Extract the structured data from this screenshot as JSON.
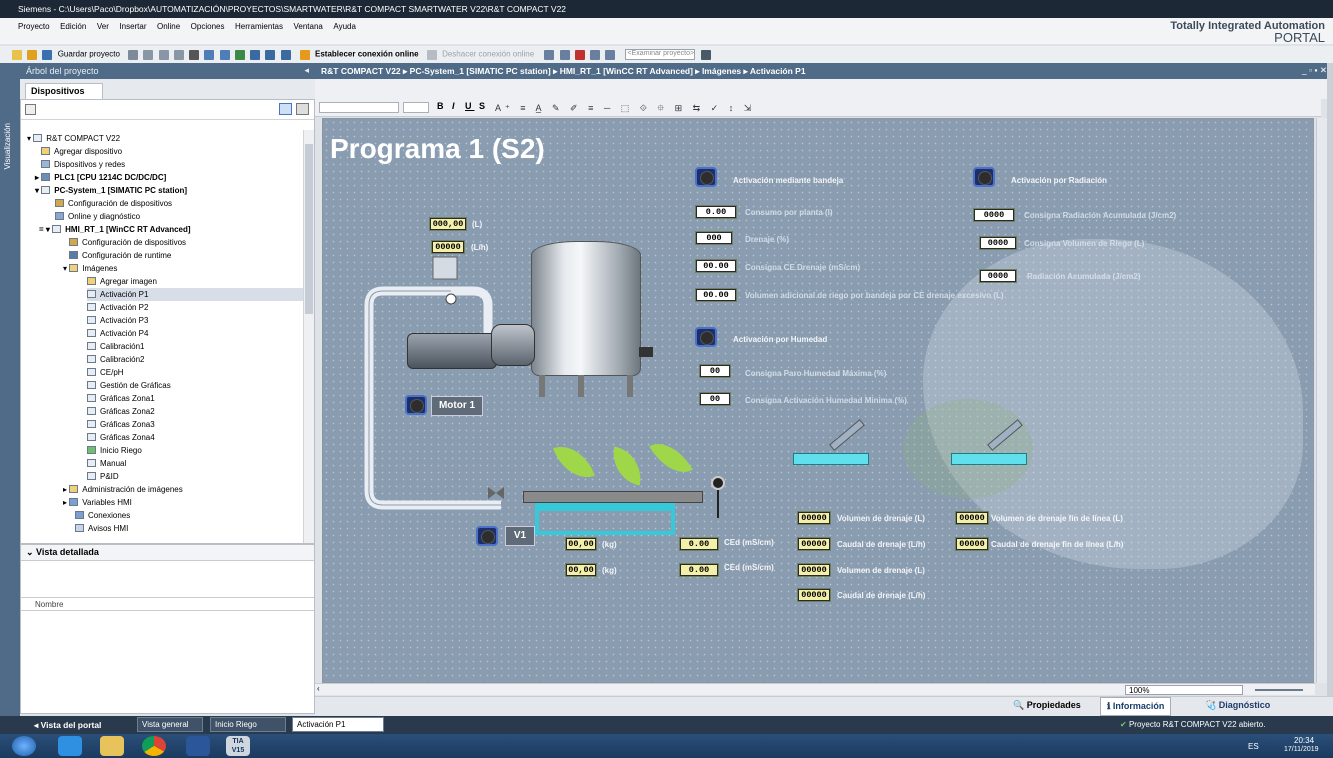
{
  "window": {
    "title": "Siemens - C:\\Users\\Paco\\Dropbox\\AUTOMATIZACIÓN\\PROYECTOS\\SMARTWATER\\R&T COMPACT SMARTWATER V22\\R&T COMPACT V22",
    "brand_line1": "Totally Integrated Automation",
    "brand_line2": "PORTAL"
  },
  "menu": [
    "Proyecto",
    "Edición",
    "Ver",
    "Insertar",
    "Online",
    "Opciones",
    "Herramientas",
    "Ventana",
    "Ayuda"
  ],
  "toolbar": {
    "save": "Guardar proyecto",
    "connect": "Establecer conexión online",
    "disconnect": "Deshacer conexión online",
    "search_placeholder": "<Examinar proyecto>"
  },
  "project_tree": {
    "header": "Árbol del proyecto",
    "tab": "Dispositivos",
    "side_label": "Visualización",
    "items": [
      {
        "label": "R&T COMPACT V22"
      },
      {
        "label": "Agregar dispositivo"
      },
      {
        "label": "Dispositivos y redes"
      },
      {
        "label": "PLC1 [CPU 1214C DC/DC/DC]"
      },
      {
        "label": "PC-System_1 [SIMATIC PC station]"
      },
      {
        "label": "Configuración de dispositivos"
      },
      {
        "label": "Online y diagnóstico"
      },
      {
        "label": "HMI_RT_1 [WinCC RT Advanced]"
      },
      {
        "label": "Configuración de dispositivos"
      },
      {
        "label": "Configuración de runtime"
      },
      {
        "label": "Imágenes"
      },
      {
        "label": "Agregar imagen"
      },
      {
        "label": "Activación P1"
      },
      {
        "label": "Activación P2"
      },
      {
        "label": "Activación P3"
      },
      {
        "label": "Activación P4"
      },
      {
        "label": "Calibración1"
      },
      {
        "label": "Calibración2"
      },
      {
        "label": "CE/pH"
      },
      {
        "label": "Gestión de Gráficas"
      },
      {
        "label": "Gráficas Zona1"
      },
      {
        "label": "Gráficas Zona2"
      },
      {
        "label": "Gráficas Zona3"
      },
      {
        "label": "Gráficas Zona4"
      },
      {
        "label": "Inicio Riego"
      },
      {
        "label": "Manual"
      },
      {
        "label": "P&ID"
      },
      {
        "label": "Administración de imágenes"
      },
      {
        "label": "Variables HMI"
      },
      {
        "label": "Conexiones"
      },
      {
        "label": "Avisos HMI"
      }
    ],
    "details_header": "Vista detallada",
    "details_col": "Nombre"
  },
  "breadcrumb": "R&T COMPACT V22  ▸  PC-System_1 [SIMATIC PC station]  ▸  HMI_RT_1 [WinCC RT Advanced]  ▸  Imágenes  ▸  Activación P1",
  "screen": {
    "title": "Programa 1 (S2)",
    "tank_fields": [
      {
        "v": "000,00",
        "u": "(L)"
      },
      {
        "v": "00000",
        "u": "(L/h)"
      }
    ],
    "motor_label": "Motor 1",
    "valve_label": "V1",
    "act_bandeja": "Activación mediante bandeja",
    "act_radiacion": "Activación por Radiación",
    "act_humedad": "Activación por Humedad",
    "left_params": [
      {
        "v": "0.00",
        "l": "Consumo por planta (l)"
      },
      {
        "v": "000",
        "l": "Drenaje (%)"
      },
      {
        "v": "00.00",
        "l": "Consigna CE Drenaje (mS/cm)"
      },
      {
        "v": "00.00",
        "l": "Volumen adicional de riego por bandeja por CE drenaje excesivo (L)"
      }
    ],
    "right_params": [
      {
        "v": "0000",
        "l": "Consigna Radiación Acumulada (J/cm2)"
      },
      {
        "v": "0000",
        "l": "Consigna Volumen de Riego (L)"
      },
      {
        "v": "0000",
        "l": "Radiación Acumulada (J/cm2)"
      }
    ],
    "hum_params": [
      {
        "v": "00",
        "l": "Consigna Paro Humedad Máxima (%)"
      },
      {
        "v": "00",
        "l": "Consigna Activación Humedad Mínima (%)"
      }
    ],
    "weights": [
      {
        "v": "00,00",
        "u": "(kg)"
      },
      {
        "v": "00,00",
        "u": "(kg)"
      }
    ],
    "ced": [
      {
        "v": "0.00",
        "u": "CEd (mS/cm)"
      },
      {
        "v": "0.00",
        "u": "CEd (mS/cm)"
      }
    ],
    "drain_mid": [
      {
        "v": "00000",
        "l": "Volumen de drenaje (L)"
      },
      {
        "v": "00000",
        "l": "Caudal de drenaje (L/h)"
      },
      {
        "v": "00000",
        "l": "Volumen de drenaje (L)"
      },
      {
        "v": "00000",
        "l": "Caudal de drenaje (L/h)"
      }
    ],
    "drain_right": [
      {
        "v": "00000",
        "l": "Volumen de drenaje fin de línea (L)"
      },
      {
        "v": "00000",
        "l": "Caudal de drenaje fin de línea (L/h)"
      }
    ]
  },
  "zoom": "100%",
  "inspector": {
    "props": "Propiedades",
    "info": "Información",
    "diag": "Diagnóstico"
  },
  "portal": {
    "back": "Vista del portal",
    "tabs": [
      "Vista general",
      "Inicio Riego",
      "Activación P1"
    ],
    "status": "Proyecto R&T COMPACT V22 abierto."
  },
  "taskbar": {
    "lang": "ES",
    "time": "20:34",
    "date": "17/11/2019",
    "tia": "TIA V15"
  }
}
